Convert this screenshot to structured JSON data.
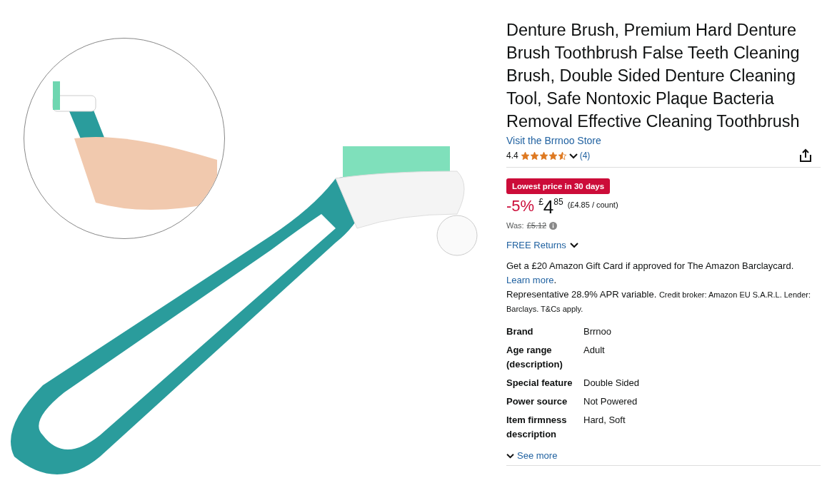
{
  "product": {
    "title": "Denture Brush, Premium Hard Denture Brush Toothbrush False Teeth Cleaning Brush, Double Sided Denture Cleaning Tool, Safe Nontoxic Plaque Bacteria Removal Effective Cleaning Toothbrush",
    "store_link": "Visit the Brrnoo Store",
    "rating": {
      "value": "4.4",
      "stars": 4.5,
      "count": "(4)"
    },
    "deal_badge": "Lowest price in 30 days",
    "price": {
      "discount": "-5%",
      "currency": "£",
      "whole": "4",
      "fraction": "85",
      "unit_price": "(£4.85 / count)"
    },
    "was": {
      "label": "Was:",
      "price": "£5.12"
    },
    "returns": "FREE Returns",
    "offer": {
      "text": "Get a £20 Amazon Gift Card if approved for The Amazon Barclaycard.",
      "link": "Learn more",
      "after_link": ".",
      "apr": "Representative 28.9% APR variable.",
      "broker": "Credit broker: Amazon EU S.A.R.L. Lender: Barclays. T&Cs apply."
    },
    "specs": [
      {
        "label": "Brand",
        "value": "Brrnoo"
      },
      {
        "label": "Age range (description)",
        "value": "Adult"
      },
      {
        "label": "Special feature",
        "value": "Double Sided"
      },
      {
        "label": "Power source",
        "value": "Not Powered"
      },
      {
        "label": "Item firmness description",
        "value": "Hard, Soft"
      }
    ],
    "see_more": "See more"
  }
}
